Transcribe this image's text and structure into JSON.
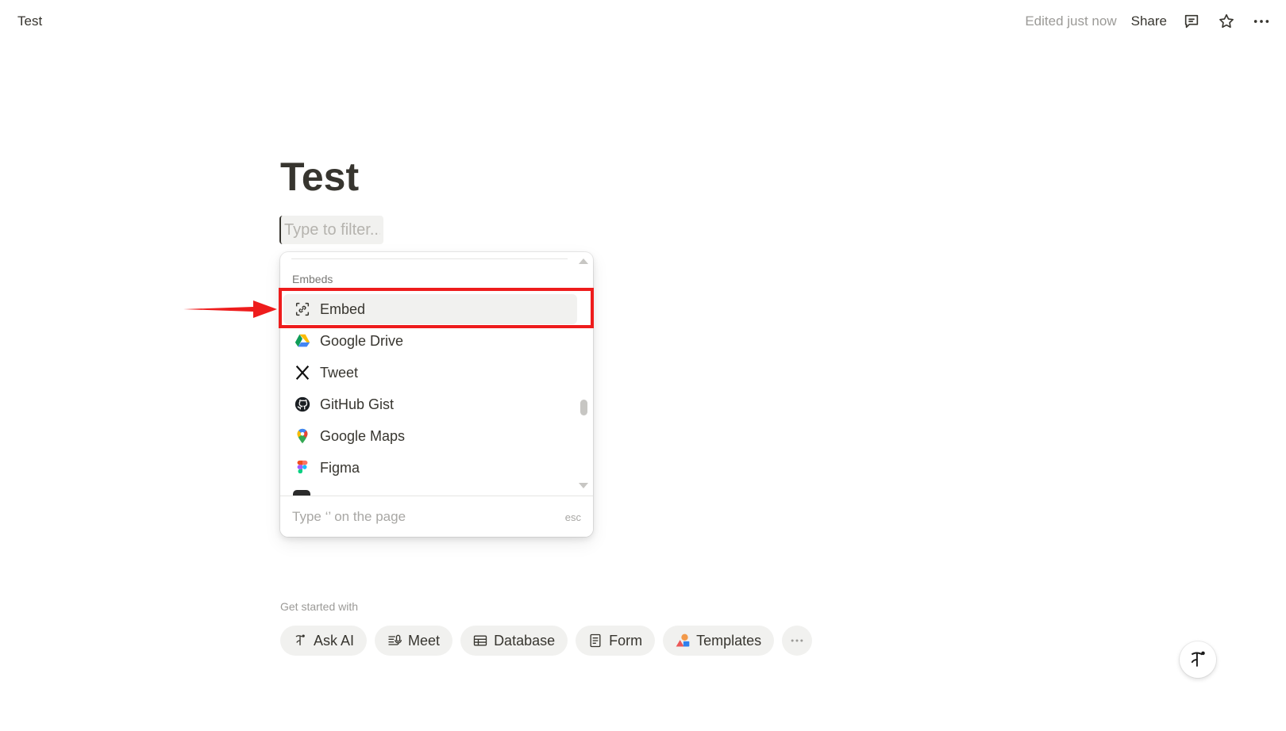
{
  "header": {
    "breadcrumb": "Test",
    "edited": "Edited just now",
    "share_label": "Share",
    "icons": [
      "comment-icon",
      "star-icon",
      "more-icon"
    ]
  },
  "page": {
    "title": "Test",
    "filter_placeholder": "Type to filter..."
  },
  "menu": {
    "section": "Embeds",
    "items": [
      {
        "label": "Embed",
        "icon": "embed-icon",
        "active": true
      },
      {
        "label": "Google Drive",
        "icon": "google-drive-icon"
      },
      {
        "label": "Tweet",
        "icon": "x-icon"
      },
      {
        "label": "GitHub Gist",
        "icon": "github-icon"
      },
      {
        "label": "Google Maps",
        "icon": "google-maps-icon"
      },
      {
        "label": "Figma",
        "icon": "figma-icon"
      }
    ],
    "footer_hint": "Type ‘’ on the page",
    "footer_esc": "esc"
  },
  "annotation": {
    "color": "#ee1c1c",
    "target": "Embed"
  },
  "get_started": {
    "label": "Get started with",
    "chips": [
      {
        "label": "Ask AI",
        "icon": "ai-icon"
      },
      {
        "label": "Meet",
        "icon": "meet-icon"
      },
      {
        "label": "Database",
        "icon": "table-icon"
      },
      {
        "label": "Form",
        "icon": "form-icon"
      },
      {
        "label": "Templates",
        "icon": "templates-icon"
      }
    ]
  },
  "colors": {
    "text": "#37352f",
    "muted": "#9b9a97",
    "chip_bg": "#f1f1ef",
    "highlight": "#ee1c1c"
  }
}
